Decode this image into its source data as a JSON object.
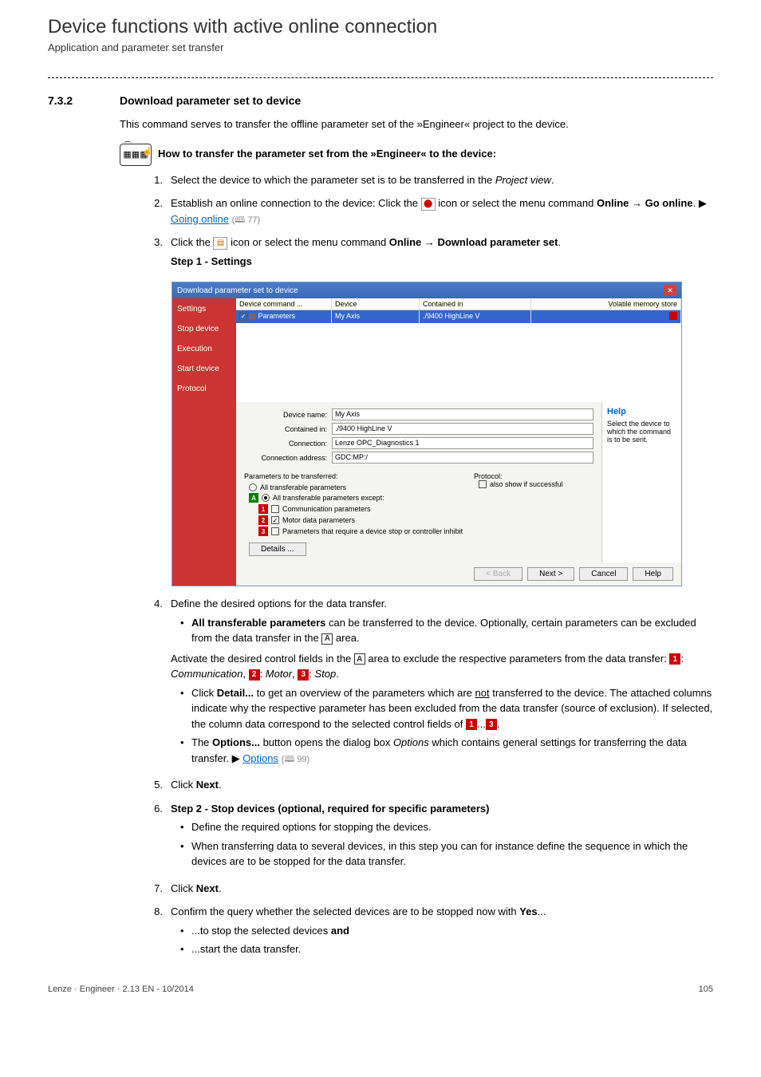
{
  "header": {
    "title": "Device functions with active online connection",
    "subtitle": "Application and parameter set transfer"
  },
  "section": {
    "number": "7.3.2",
    "title": "Download parameter set to device"
  },
  "intro": "This command serves to transfer the offline parameter set of the »Engineer« project to the device.",
  "howto": {
    "title": "How to transfer the parameter set from the »Engineer« to the device:",
    "icon_label": "▦▦▦"
  },
  "steps": {
    "s1": {
      "num": "1.",
      "text_a": "Select the device to which the parameter set is to be transferred in the ",
      "text_em": "Project view",
      "text_b": "."
    },
    "s2": {
      "num": "2.",
      "text_a": "Establish an online connection to the device: Click the ",
      "text_b": " icon or select the menu command ",
      "bold_a": "Online → Go online",
      "text_c": ".  ▶ ",
      "link": "Going online",
      "ref": "(🕮 77)"
    },
    "s3": {
      "num": "3.",
      "text_a": "Click the ",
      "text_b": " icon or select the menu command ",
      "bold_a": "Online → Download parameter set",
      "text_c": ".",
      "heading": "Step 1 - Settings"
    },
    "s4": {
      "num": "4.",
      "text_a": "Define the desired options for the data transfer.",
      "bullet1_a": "All transferable parameters",
      "bullet1_b": " can be transferred to the device. Optionally, certain parameters can be excluded from the data transfer in the ",
      "bullet1_c": " area.",
      "para_a": "Activate the desired control fields in the ",
      "para_b": " area to exclude the respective parameters from the data transfer: ",
      "p1": "1",
      "p1_label": "Communication",
      "p2": "2",
      "p2_label": "Motor",
      "p3": "3",
      "p3_label": "Stop",
      "letter": "A",
      "bullet2_a": "Click ",
      "bullet2_bold": "Detail...",
      "bullet2_b": " to get an overview of the parameters which are ",
      "bullet2_u": "not",
      "bullet2_c": " transferred to the device. The attached columns indicate why the respective parameter has been excluded from the data transfer (source of exclusion). If selected, the column data correspond to the selected control fields of  ",
      "bullet2_d": "...",
      "bullet3_a": "The ",
      "bullet3_bold": "Options...",
      "bullet3_b": " button opens the dialog box ",
      "bullet3_em": "Options",
      "bullet3_c": " which contains general settings for transferring the data transfer.  ▶ ",
      "bullet3_link": "Options",
      "bullet3_ref": "(🕮 99)"
    },
    "s5": {
      "num": "5.",
      "text_a": "Click ",
      "bold": "Next",
      "text_b": "."
    },
    "s6": {
      "num": "6.",
      "bold": "Step 2 - Stop devices (optional, required for specific parameters)",
      "b1": "Define the required options for stopping the devices.",
      "b2": "When transferring data to several devices, in this step you can for instance define the sequence in which the devices are to be stopped for the data transfer."
    },
    "s7": {
      "num": "7.",
      "text_a": "Click ",
      "bold": "Next",
      "text_b": "."
    },
    "s8": {
      "num": "8.",
      "text_a": "Confirm the query whether the selected devices are to be stopped now with ",
      "bold": "Yes",
      "text_b": "...",
      "b1_a": "...to stop the selected devices ",
      "b1_bold": "and",
      "b2": "...start the data transfer."
    }
  },
  "screenshot": {
    "title": "Download parameter set to device",
    "close": "✕",
    "sidebar": {
      "i1": "Settings",
      "i2": "Stop device",
      "i3": "Execution",
      "i4": "Start device",
      "i5": "Protocol"
    },
    "table": {
      "h1": "Device command ...",
      "h2": "Device",
      "h3": "Contained in",
      "h4": "Volatile memory store",
      "r1c1": "Parameters",
      "r1c2": "My Axis",
      "r1c3": "./9400 HighLine V"
    },
    "form": {
      "l1": "Device name:",
      "v1": "My Axis",
      "l2": "Contained in:",
      "v2": "./9400 HighLine V",
      "l3": "Connection:",
      "v3": "Lenze OPC_Diagnostics 1",
      "l4": "Connection address:",
      "v4": "GDC:MP:/"
    },
    "params": {
      "title": "Parameters to be transferred:",
      "r1": "All transferable parameters",
      "r2": "All transferable parameters except:",
      "c1": "Communication parameters",
      "c2": "Motor data parameters",
      "c3": "Parameters that require a device stop or controller inhibit",
      "details_btn": "Details ..."
    },
    "protocol": {
      "title": "Protocol:",
      "c1": "also show if successful"
    },
    "help": {
      "title": "Help",
      "text": "Select the device to which the command is to be sent."
    },
    "buttons": {
      "back": "< Back",
      "next": "Next >",
      "cancel": "Cancel",
      "help": "Help"
    },
    "markers": {
      "A": "A",
      "n1": "1",
      "n2": "2",
      "n3": "3"
    }
  },
  "footer": {
    "left": "Lenze · Engineer · 2.13 EN - 10/2014",
    "right": "105"
  }
}
